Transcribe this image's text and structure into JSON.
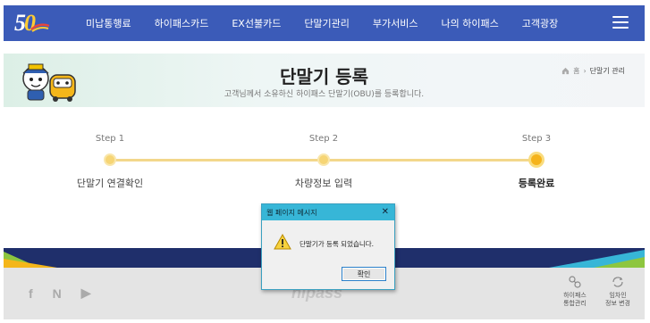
{
  "nav": {
    "logo_text_5": "5",
    "logo_text_0": "0",
    "items": [
      {
        "label": "미납통행료"
      },
      {
        "label": "하이패스카드"
      },
      {
        "label": "EX선불카드"
      },
      {
        "label": "단말기관리"
      },
      {
        "label": "부가서비스"
      },
      {
        "label": "나의 하이패스"
      },
      {
        "label": "고객광장"
      }
    ]
  },
  "banner": {
    "title": "단말기 등록",
    "subtitle": "고객님께서 소유하신 하이패스 단말기(OBU)를 등록합니다.",
    "breadcrumb": {
      "home": "홈",
      "separator": "›",
      "current": "단말기 관리"
    }
  },
  "steps": [
    {
      "step": "Step 1",
      "name": "단말기 연결확인",
      "status": "pending"
    },
    {
      "step": "Step 2",
      "name": "차량정보 입력",
      "status": "pending"
    },
    {
      "step": "Step 3",
      "name": "등록완료",
      "status": "current"
    }
  ],
  "footer": {
    "social": [
      "f",
      "N",
      "▶"
    ],
    "logo_text": "hipass",
    "links": [
      {
        "label_line1": "하이패스",
        "label_line2": "통합관리"
      },
      {
        "label_line1": "임차인",
        "label_line2": "정보 변경"
      }
    ]
  },
  "dialog": {
    "title": "웹 페이지 메시지",
    "close": "✕",
    "message": "단말기가 등록 되었습니다.",
    "ok_label": "확인"
  },
  "colors": {
    "nav_bg": "#3b5bb8",
    "dialog_title_bg": "#37b6d7",
    "step_dot": "#f5b31c",
    "step_line": "#f3d78b"
  }
}
